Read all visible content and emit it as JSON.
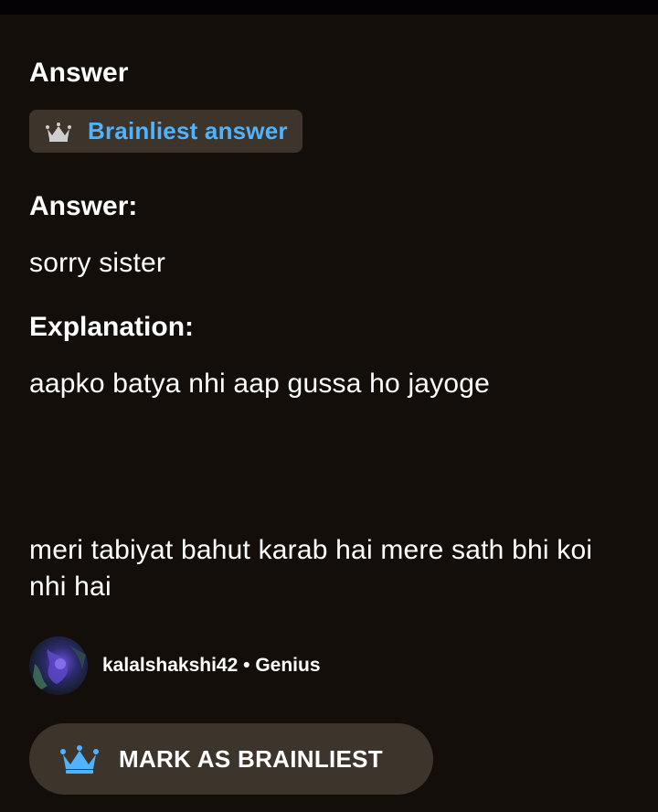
{
  "answer_section": {
    "title": "Answer",
    "badge_label": "Brainliest answer"
  },
  "body": {
    "answer_heading": "Answer:",
    "answer_text": "sorry sister",
    "explanation_heading": "Explanation:",
    "explanation_line1": "aapko batya nhi aap gussa ho jayoge",
    "explanation_line2": "meri tabiyat bahut karab hai mere sath bhi koi nhi hai"
  },
  "author": {
    "username": "kalalshakshi42",
    "separator": "•",
    "rank": "Genius"
  },
  "actions": {
    "mark_brainliest_label": "MARK AS BRAINLIEST"
  },
  "colors": {
    "background": "#140e0a",
    "badge_bg": "#3d342c",
    "badge_text": "#4fb3ff",
    "button_bg": "#3d342c",
    "crown_blue": "#4fb3ff"
  },
  "icons": {
    "badge_icon": "crown-icon",
    "button_icon": "crown-icon"
  }
}
